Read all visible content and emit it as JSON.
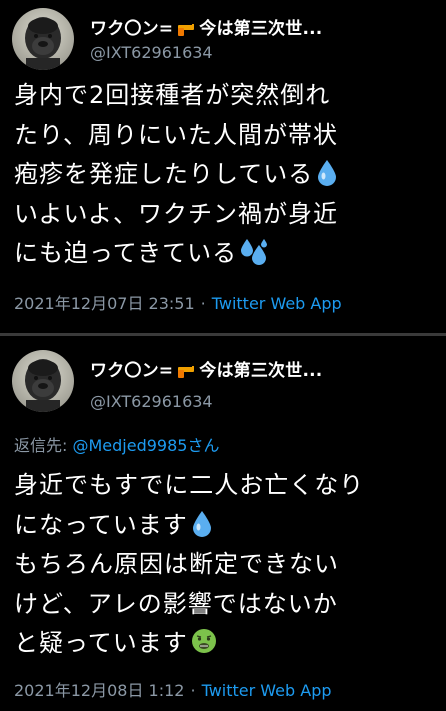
{
  "tweets": [
    {
      "display_name_prefix": "ワク〇ン=",
      "display_name_suffix": "今は第三次世...",
      "handle": "@IXT62961634",
      "body_lines": [
        "身内で2回接種者が突然倒れ",
        "たり、周りにいた人間が帯状",
        "疱疹を発症したりしている",
        "いよいよ、ワクチン禍が身近",
        "にも迫ってきている"
      ],
      "timestamp": "2021年12月07日 23:51",
      "separator": "·",
      "source": "Twitter Web App",
      "emojis": [
        "droplet-emoji",
        "sweat-droplets-emoji"
      ]
    },
    {
      "display_name_prefix": "ワク〇ン=",
      "display_name_suffix": "今は第三次世...",
      "handle": "@IXT62961634",
      "reply_prefix": "返信先: ",
      "reply_to": "@Medjed9985さん",
      "body_lines": [
        "身近でもすでに二人お亡くなり",
        "になっています",
        "もちろん原因は断定できない",
        "けど、アレの影響ではないか",
        "と疑っています"
      ],
      "timestamp": "2021年12月08日 1:12",
      "separator": "·",
      "source": "Twitter Web App",
      "emojis": [
        "droplet-emoji",
        "nauseated-face-emoji"
      ]
    }
  ],
  "colors": {
    "background": "#000000",
    "text": "#ffffff",
    "secondary": "#8b98a5",
    "link": "#1d9bf0",
    "divider": "#3a3a3a"
  }
}
